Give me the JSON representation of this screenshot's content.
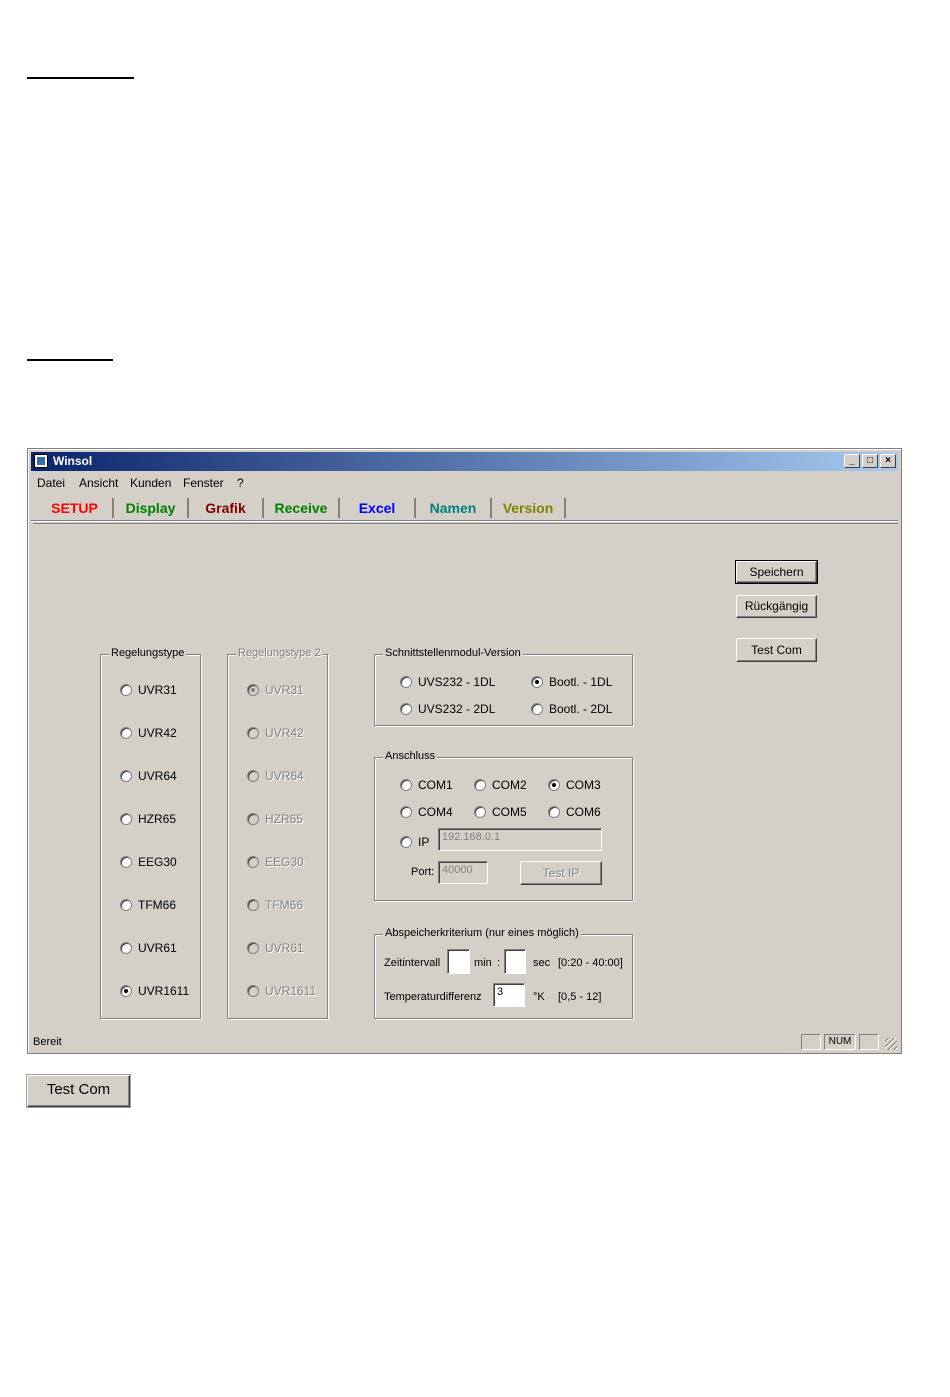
{
  "window": {
    "title": "Winsol"
  },
  "menu": [
    "Datei",
    "Ansicht",
    "Kunden",
    "Fenster",
    "?"
  ],
  "tabs": [
    {
      "label": "SETUP",
      "color": "#ff0000"
    },
    {
      "label": "Display",
      "color": "#008000"
    },
    {
      "label": "Grafik",
      "color": "#800000"
    },
    {
      "label": "Receive",
      "color": "#008000"
    },
    {
      "label": "Excel",
      "color": "#0000ff"
    },
    {
      "label": "Namen",
      "color": "#008080"
    },
    {
      "label": "Version",
      "color": "#808000"
    }
  ],
  "buttons": {
    "save": "Speichern",
    "undo": "Rückgängig",
    "test_com": "Test Com",
    "test_ip": "Test IP"
  },
  "regelungstype": {
    "title": "Regelungstype",
    "items": [
      "UVR31",
      "UVR42",
      "UVR64",
      "HZR65",
      "EEG30",
      "TFM66",
      "UVR61",
      "UVR1611"
    ],
    "selected": "UVR1611"
  },
  "regelungstype2": {
    "title": "Regelungstype 2",
    "items": [
      "UVR31",
      "UVR42",
      "UVR64",
      "HZR65",
      "EEG30",
      "TFM66",
      "UVR61",
      "UVR1611"
    ],
    "selected": "UVR31"
  },
  "modul": {
    "title": "Schnittstellenmodul-Version",
    "items": [
      "UVS232 - 1DL",
      "Bootl. - 1DL",
      "UVS232 - 2DL",
      "Bootl. - 2DL"
    ],
    "selected": "Bootl. - 1DL"
  },
  "anschluss": {
    "title": "Anschluss",
    "items": [
      "COM1",
      "COM2",
      "COM3",
      "COM4",
      "COM5",
      "COM6",
      "IP"
    ],
    "selected": "COM3",
    "ip_value": "192.168.0.1",
    "port_label": "Port:",
    "port_value": "40000"
  },
  "speicher": {
    "title": "Abspeicherkriterium (nur eines möglich)",
    "zeit_label": "Zeitintervall",
    "min_label": "min",
    "colon": ":",
    "sec_label": "sec",
    "zeit_range": "[0:20 - 40:00]",
    "temp_label": "Temperaturdifferenz",
    "temp_value": "3",
    "unit": "°K",
    "temp_range": "[0,5 - 12]"
  },
  "status": {
    "text": "Bereit",
    "num": "NUM"
  },
  "outside_button": "Test Com"
}
